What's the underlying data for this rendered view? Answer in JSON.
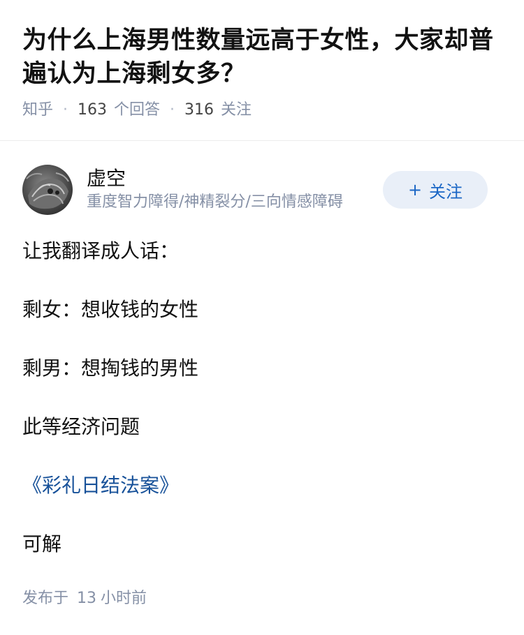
{
  "question": {
    "title": "为什么上海男性数量远高于女性，大家却普遍认为上海剩女多？",
    "source": "知乎",
    "answers_count": "163",
    "answers_label": "个回答",
    "followers_count": "316",
    "followers_label": "关注"
  },
  "author": {
    "name": "虚空",
    "bio": "重度智力障得/神精裂分/三向情感障碍",
    "follow_label": "关注",
    "follow_icon": "plus-icon"
  },
  "answer": {
    "paragraphs": [
      "让我翻译成人话：",
      "剩女：想收钱的女性",
      "剩男：想掏钱的男性",
      "此等经济问题",
      "《彩礼日结法案》",
      "可解"
    ]
  },
  "publish": {
    "prefix": "发布于",
    "amount": "13",
    "unit": "小时前"
  },
  "colors": {
    "link": "#175199",
    "follow_bg": "#e9eff8",
    "follow_text": "#1a66c5",
    "meta": "#8590a6"
  }
}
